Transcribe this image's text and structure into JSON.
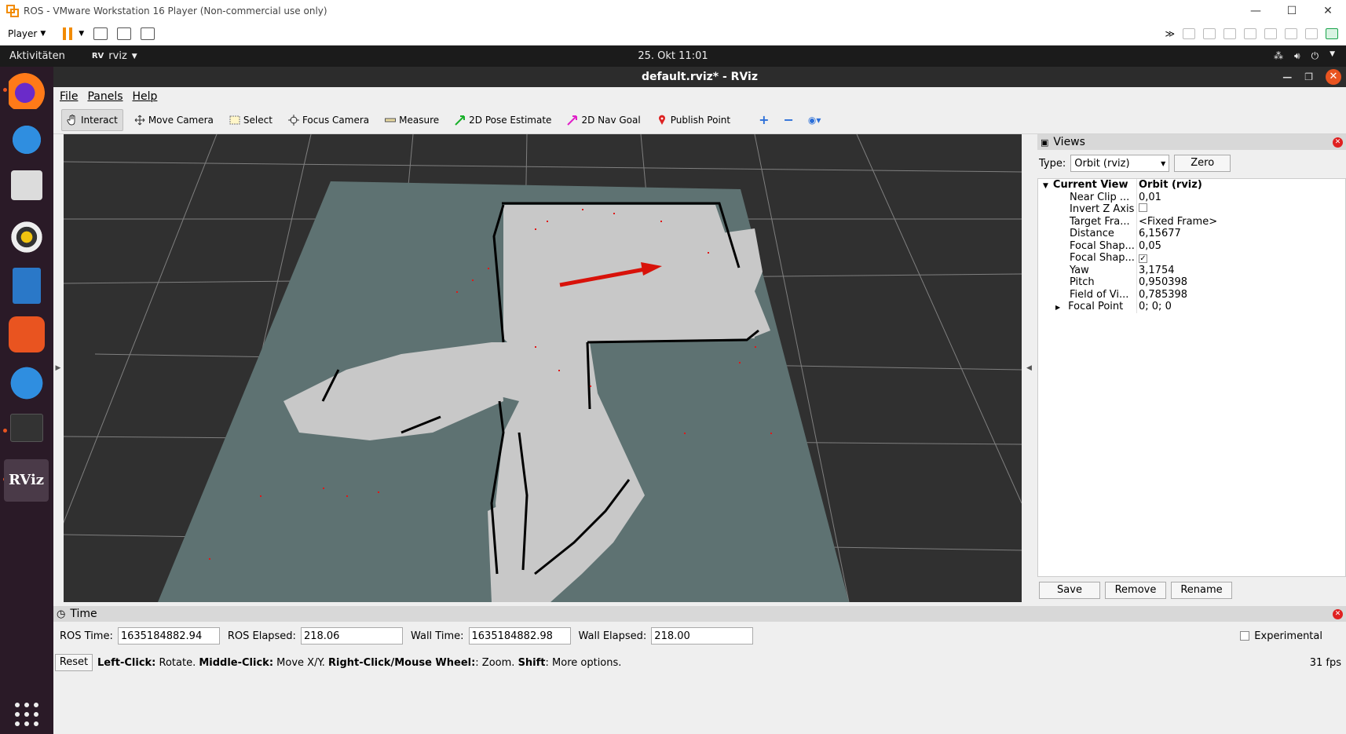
{
  "vmware": {
    "title": "ROS - VMware Workstation 16 Player (Non-commercial use only)",
    "player_label": "Player",
    "min": "—",
    "max": "☐",
    "close": "✕"
  },
  "gnome": {
    "activities": "Aktivitäten",
    "app_name": "rviz",
    "clock": "25. Okt  11:01"
  },
  "rviz": {
    "title": "default.rviz* - RViz",
    "menu": [
      "File",
      "Panels",
      "Help"
    ],
    "tools": [
      {
        "label": "Interact",
        "icon": "hand-icon"
      },
      {
        "label": "Move Camera",
        "icon": "move-camera-icon"
      },
      {
        "label": "Select",
        "icon": "select-icon"
      },
      {
        "label": "Focus Camera",
        "icon": "focus-camera-icon"
      },
      {
        "label": "Measure",
        "icon": "ruler-icon"
      },
      {
        "label": "2D Pose Estimate",
        "icon": "green-arrow-icon"
      },
      {
        "label": "2D Nav Goal",
        "icon": "magenta-arrow-icon"
      },
      {
        "label": "Publish Point",
        "icon": "pin-icon"
      }
    ]
  },
  "views": {
    "title": "Views",
    "type_label": "Type:",
    "type_value": "Orbit (rviz)",
    "zero": "Zero",
    "current_view": {
      "key": "Current View",
      "value": "Orbit (rviz)"
    },
    "props": [
      {
        "key": "Near Clip ...",
        "value": "0,01"
      },
      {
        "key": "Invert Z Axis",
        "value": ""
      },
      {
        "key": "Target Fra...",
        "value": "<Fixed Frame>"
      },
      {
        "key": "Distance",
        "value": "6,15677"
      },
      {
        "key": "Focal Shap...",
        "value": "0,05"
      },
      {
        "key": "Focal Shap...",
        "value": "✓"
      },
      {
        "key": "Yaw",
        "value": "3,1754"
      },
      {
        "key": "Pitch",
        "value": "0,950398"
      },
      {
        "key": "Field of Vi...",
        "value": "0,785398"
      },
      {
        "key": "Focal Point",
        "value": "0; 0; 0"
      }
    ],
    "buttons": [
      "Save",
      "Remove",
      "Rename"
    ]
  },
  "time": {
    "title": "Time",
    "ros_time_label": "ROS Time:",
    "ros_time": "1635184882.94",
    "ros_elapsed_label": "ROS Elapsed:",
    "ros_elapsed": "218.06",
    "wall_time_label": "Wall Time:",
    "wall_time": "1635184882.98",
    "wall_elapsed_label": "Wall Elapsed:",
    "wall_elapsed": "218.00",
    "experimental": "Experimental",
    "reset": "Reset",
    "hint_b1": "Left-Click:",
    "hint_t1": " Rotate. ",
    "hint_b2": "Middle-Click:",
    "hint_t2": " Move X/Y. ",
    "hint_b3": "Right-Click/Mouse Wheel:",
    "hint_t3": ": Zoom. ",
    "hint_b4": "Shift",
    "hint_t4": ": More options.",
    "fps": "31 fps"
  },
  "colors": {
    "accent": "#e95420",
    "map_bg": "#5e7272",
    "grid": "#8a8a8a",
    "pose_arrow": "#d8120a"
  }
}
